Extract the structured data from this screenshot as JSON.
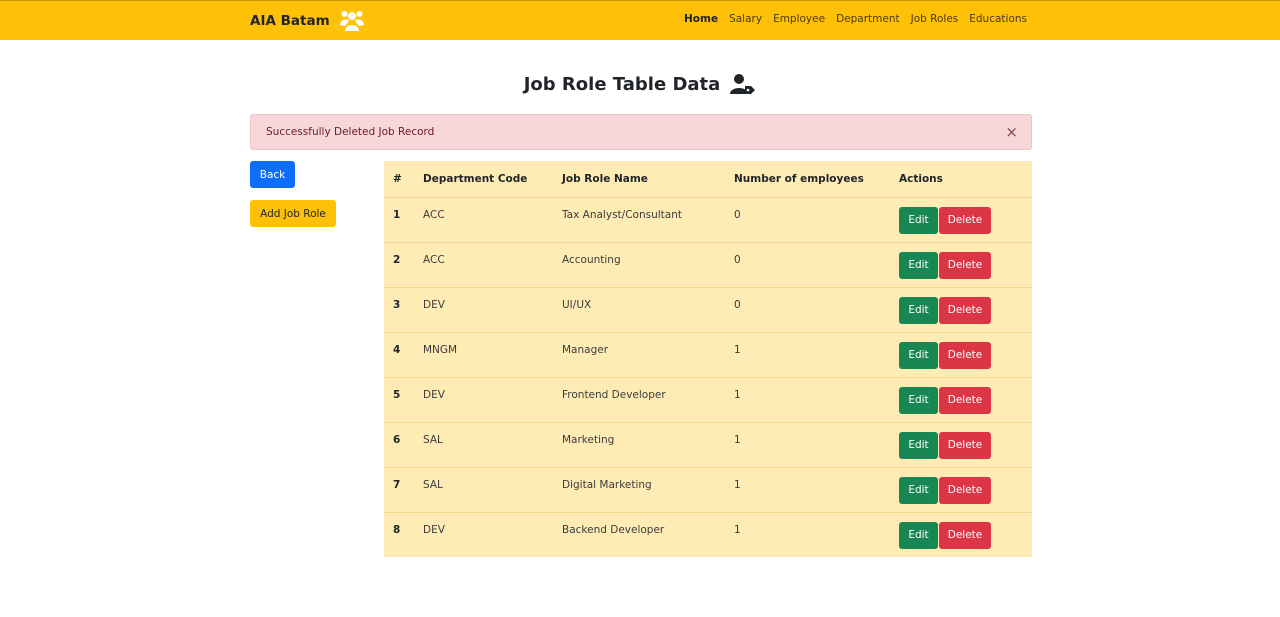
{
  "navbar": {
    "brand": "AIA Batam",
    "brand_icon": "users-icon",
    "links": [
      {
        "label": "Home",
        "active": true
      },
      {
        "label": "Salary",
        "active": false
      },
      {
        "label": "Employee",
        "active": false
      },
      {
        "label": "Department",
        "active": false
      },
      {
        "label": "Job Roles",
        "active": false
      },
      {
        "label": "Educations",
        "active": false
      }
    ]
  },
  "page": {
    "title": "Job Role Table Data",
    "title_icon": "user-tag-icon"
  },
  "alert": {
    "message": "Successfully Deleted Job Record",
    "close_symbol": "×"
  },
  "buttons": {
    "back": "Back",
    "add": "Add Job Role",
    "edit": "Edit",
    "delete": "Delete"
  },
  "table": {
    "headers": [
      "#",
      "Department Code",
      "Job Role Name",
      "Number of employees",
      "Actions"
    ],
    "rows": [
      {
        "num": "1",
        "code": "ACC",
        "name": "Tax Analyst/Consultant",
        "employees": "0"
      },
      {
        "num": "2",
        "code": "ACC",
        "name": "Accounting",
        "employees": "0"
      },
      {
        "num": "3",
        "code": "DEV",
        "name": "UI/UX",
        "employees": "0"
      },
      {
        "num": "4",
        "code": "MNGM",
        "name": "Manager",
        "employees": "1"
      },
      {
        "num": "5",
        "code": "DEV",
        "name": "Frontend Developer",
        "employees": "1"
      },
      {
        "num": "6",
        "code": "SAL",
        "name": "Marketing",
        "employees": "1"
      },
      {
        "num": "7",
        "code": "SAL",
        "name": "Digital Marketing",
        "employees": "1"
      },
      {
        "num": "8",
        "code": "DEV",
        "name": "Backend Developer",
        "employees": "1"
      }
    ]
  },
  "colors": {
    "navbar": "#ffc107",
    "primary": "#0d6efd",
    "success": "#198754",
    "danger": "#dc3545",
    "alert_bg": "#f8d7da",
    "table_bg": "#ffecb5"
  }
}
